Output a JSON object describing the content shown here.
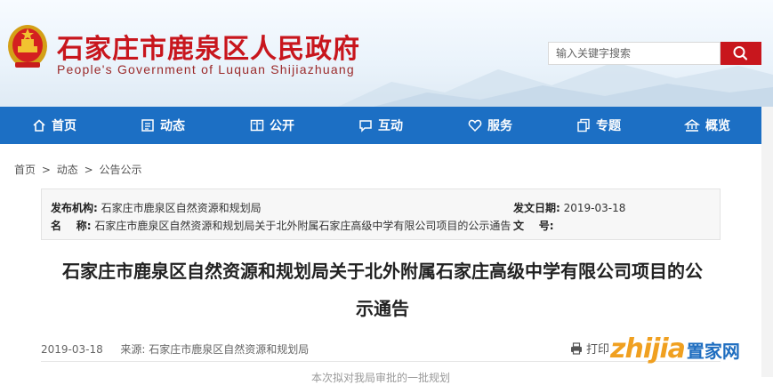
{
  "header": {
    "title": "石家庄市鹿泉区人民政府",
    "subtitle": "People's Government of Luquan Shijiazhuang",
    "search_placeholder": "输入关键字搜索"
  },
  "nav": {
    "items": [
      {
        "label": "首页",
        "icon": "home-icon"
      },
      {
        "label": "动态",
        "icon": "news-icon"
      },
      {
        "label": "公开",
        "icon": "book-icon"
      },
      {
        "label": "互动",
        "icon": "chat-icon"
      },
      {
        "label": "服务",
        "icon": "heart-icon"
      },
      {
        "label": "专题",
        "icon": "copy-icon"
      },
      {
        "label": "概览",
        "icon": "landmark-icon"
      }
    ]
  },
  "breadcrumb": {
    "home": "首页",
    "sep": ">",
    "level1": "动态",
    "level2": "公告公示"
  },
  "meta": {
    "publisher_label": "发布机构:",
    "publisher": "石家庄市鹿泉区自然资源和规划局",
    "date_label": "发文日期:",
    "date": "2019-03-18",
    "name_label": "名    称:",
    "name": "石家庄市鹿泉区自然资源和规划局关于北外附属石家庄高级中学有限公司项目的公示通告",
    "doc_no_label": "文    号:",
    "doc_no": ""
  },
  "article": {
    "title_line1": "石家庄市鹿泉区自然资源和规划局关于北外附属石家庄高级中学有限公司项目的公",
    "title_line2": "示通告",
    "date": "2019-03-18",
    "source_label": "来源:",
    "source": "石家庄市鹿泉区自然资源和规划局",
    "print_label": "打印",
    "body_start": "本次拟对我局审批的一批规划"
  },
  "watermark": {
    "latin": "zhijia",
    "cn": "置家网"
  },
  "colors": {
    "brand_red": "#c8161d",
    "nav_blue": "#1c6fc4",
    "watermark_orange": "#f0a020",
    "watermark_blue": "#1f6ec0"
  }
}
